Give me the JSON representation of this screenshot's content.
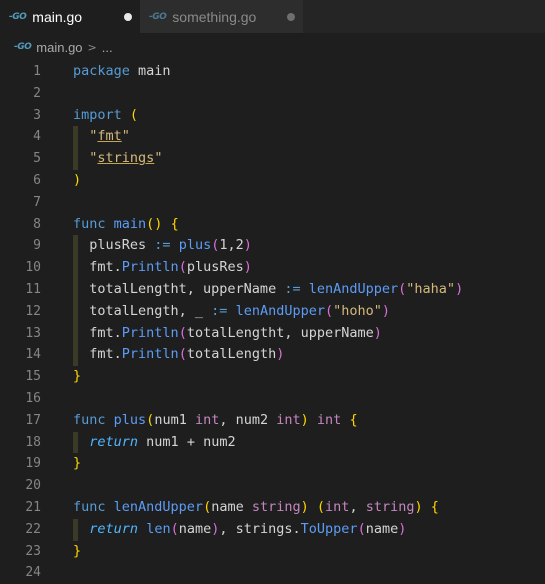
{
  "tabs": [
    {
      "label": "main.go",
      "icon": "go-file-icon",
      "active": true,
      "dirty": true
    },
    {
      "label": "something.go",
      "icon": "go-file-icon",
      "active": false,
      "dirty": true
    }
  ],
  "icon_text": "-GO",
  "breadcrumb": {
    "file": "main.go",
    "separator": ">",
    "more": "..."
  },
  "colors": {
    "background": "#1e1e1e",
    "keyword": "#569cd6",
    "function": "#5c9cf5",
    "bracket_1": "#ffd700",
    "bracket_2": "#da70d6",
    "string": "#d4b97e",
    "type": "#c586c0",
    "line_number": "#858585"
  },
  "lines": [
    {
      "n": "1",
      "indent": false,
      "tokens": [
        [
          "kw",
          "package"
        ],
        [
          "pl",
          " main"
        ]
      ]
    },
    {
      "n": "2",
      "indent": false,
      "tokens": []
    },
    {
      "n": "3",
      "indent": false,
      "tokens": [
        [
          "kw",
          "import"
        ],
        [
          "pl",
          " "
        ],
        [
          "p1",
          "("
        ]
      ]
    },
    {
      "n": "4",
      "indent": true,
      "tokens": [
        [
          "pl",
          "  "
        ],
        [
          "str",
          "\""
        ],
        [
          "stru",
          "fmt"
        ],
        [
          "str",
          "\""
        ]
      ]
    },
    {
      "n": "5",
      "indent": true,
      "tokens": [
        [
          "pl",
          "  "
        ],
        [
          "str",
          "\""
        ],
        [
          "stru",
          "strings"
        ],
        [
          "str",
          "\""
        ]
      ]
    },
    {
      "n": "6",
      "indent": false,
      "tokens": [
        [
          "p1",
          ")"
        ]
      ]
    },
    {
      "n": "7",
      "indent": false,
      "tokens": []
    },
    {
      "n": "8",
      "indent": false,
      "tokens": [
        [
          "kw",
          "func"
        ],
        [
          "pl",
          " "
        ],
        [
          "fn",
          "main"
        ],
        [
          "p1",
          "()"
        ],
        [
          "pl",
          " "
        ],
        [
          "p1",
          "{"
        ]
      ]
    },
    {
      "n": "9",
      "indent": true,
      "tokens": [
        [
          "pl",
          "  plusRes "
        ],
        [
          "kw",
          ":="
        ],
        [
          "pl",
          " "
        ],
        [
          "fn",
          "plus"
        ],
        [
          "p2",
          "("
        ],
        [
          "num",
          "1"
        ],
        [
          "pl",
          ","
        ],
        [
          "num",
          "2"
        ],
        [
          "p2",
          ")"
        ]
      ]
    },
    {
      "n": "10",
      "indent": true,
      "tokens": [
        [
          "pl",
          "  fmt."
        ],
        [
          "fn",
          "Println"
        ],
        [
          "p2",
          "("
        ],
        [
          "pl",
          "plusRes"
        ],
        [
          "p2",
          ")"
        ]
      ]
    },
    {
      "n": "11",
      "indent": true,
      "tokens": [
        [
          "pl",
          "  totalLengtht, upperName "
        ],
        [
          "kw",
          ":="
        ],
        [
          "pl",
          " "
        ],
        [
          "fn",
          "lenAndUpper"
        ],
        [
          "p2",
          "("
        ],
        [
          "str",
          "\"haha\""
        ],
        [
          "p2",
          ")"
        ]
      ]
    },
    {
      "n": "12",
      "indent": true,
      "tokens": [
        [
          "pl",
          "  totalLength, _ "
        ],
        [
          "kw",
          ":="
        ],
        [
          "pl",
          " "
        ],
        [
          "fn",
          "lenAndUpper"
        ],
        [
          "p2",
          "("
        ],
        [
          "str",
          "\"hoho\""
        ],
        [
          "p2",
          ")"
        ]
      ]
    },
    {
      "n": "13",
      "indent": true,
      "tokens": [
        [
          "pl",
          "  fmt."
        ],
        [
          "fn",
          "Println"
        ],
        [
          "p2",
          "("
        ],
        [
          "pl",
          "totalLengtht, upperName"
        ],
        [
          "p2",
          ")"
        ]
      ]
    },
    {
      "n": "14",
      "indent": true,
      "tokens": [
        [
          "pl",
          "  fmt."
        ],
        [
          "fn",
          "Println"
        ],
        [
          "p2",
          "("
        ],
        [
          "pl",
          "totalLength"
        ],
        [
          "p2",
          ")"
        ]
      ]
    },
    {
      "n": "15",
      "indent": false,
      "tokens": [
        [
          "p1",
          "}"
        ]
      ]
    },
    {
      "n": "16",
      "indent": false,
      "tokens": []
    },
    {
      "n": "17",
      "indent": false,
      "tokens": [
        [
          "kw",
          "func"
        ],
        [
          "pl",
          " "
        ],
        [
          "fn",
          "plus"
        ],
        [
          "p1",
          "("
        ],
        [
          "pl",
          "num1 "
        ],
        [
          "ty",
          "int"
        ],
        [
          "pl",
          ", num2 "
        ],
        [
          "ty",
          "int"
        ],
        [
          "p1",
          ")"
        ],
        [
          "pl",
          " "
        ],
        [
          "ty",
          "int"
        ],
        [
          "pl",
          " "
        ],
        [
          "p1",
          "{"
        ]
      ]
    },
    {
      "n": "18",
      "indent": true,
      "tokens": [
        [
          "pl",
          "  "
        ],
        [
          "ret",
          "return"
        ],
        [
          "pl",
          " num1 "
        ],
        [
          "op",
          "+"
        ],
        [
          "pl",
          " num2"
        ]
      ]
    },
    {
      "n": "19",
      "indent": false,
      "tokens": [
        [
          "p1",
          "}"
        ]
      ]
    },
    {
      "n": "20",
      "indent": false,
      "tokens": []
    },
    {
      "n": "21",
      "indent": false,
      "tokens": [
        [
          "kw",
          "func"
        ],
        [
          "pl",
          " "
        ],
        [
          "fn",
          "lenAndUpper"
        ],
        [
          "p1",
          "("
        ],
        [
          "pl",
          "name "
        ],
        [
          "ty",
          "string"
        ],
        [
          "p1",
          ")"
        ],
        [
          "pl",
          " "
        ],
        [
          "p1",
          "("
        ],
        [
          "ty",
          "int"
        ],
        [
          "pl",
          ", "
        ],
        [
          "ty",
          "string"
        ],
        [
          "p1",
          ")"
        ],
        [
          "pl",
          " "
        ],
        [
          "p1",
          "{"
        ]
      ]
    },
    {
      "n": "22",
      "indent": true,
      "tokens": [
        [
          "pl",
          "  "
        ],
        [
          "ret",
          "return"
        ],
        [
          "pl",
          " "
        ],
        [
          "fn",
          "len"
        ],
        [
          "p2",
          "("
        ],
        [
          "pl",
          "name"
        ],
        [
          "p2",
          ")"
        ],
        [
          "pl",
          ", strings."
        ],
        [
          "fn",
          "ToUpper"
        ],
        [
          "p2",
          "("
        ],
        [
          "pl",
          "name"
        ],
        [
          "p2",
          ")"
        ]
      ]
    },
    {
      "n": "23",
      "indent": false,
      "tokens": [
        [
          "p1",
          "}"
        ]
      ]
    },
    {
      "n": "24",
      "indent": false,
      "tokens": []
    }
  ]
}
